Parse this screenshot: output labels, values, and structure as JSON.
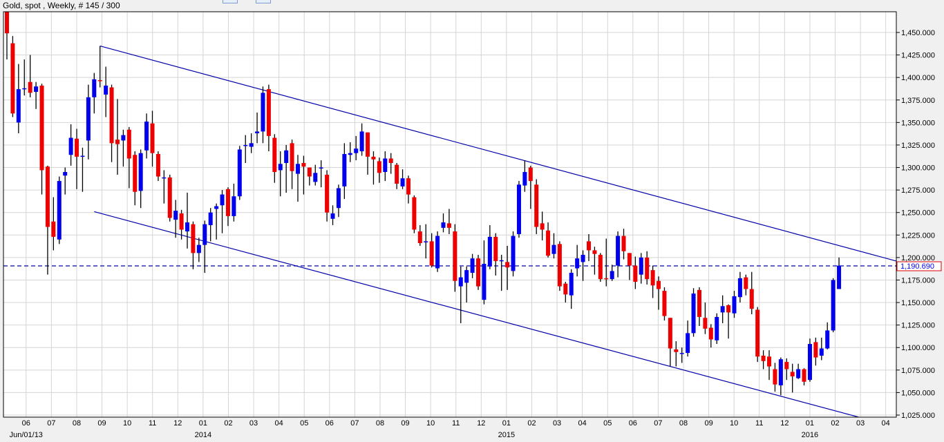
{
  "header": {
    "title": "Gold, spot , Weekly, # 145 / 300"
  },
  "colors": {
    "up": "#0000ee",
    "down": "#ee0000",
    "trend": "#0000aa",
    "grid": "#d4d4d4",
    "price_box": "#dd0000"
  },
  "chart_data": {
    "type": "candlestick",
    "title": "Gold, spot , Weekly, # 145 / 300",
    "ylim": [
      1025,
      1450
    ],
    "ytick_step": 25,
    "yticks": [
      "1,025.000",
      "1,050.000",
      "1,075.000",
      "1,100.000",
      "1,125.000",
      "1,150.000",
      "1,175.000",
      "1,200.000",
      "1,225.000",
      "1,250.000",
      "1,275.000",
      "1,300.000",
      "1,325.000",
      "1,350.000",
      "1,375.000",
      "1,400.000",
      "1,425.000",
      "1,450.000"
    ],
    "current_price": 1190.69,
    "current_price_label": "1,190.690",
    "x_first_month_week": 3.3,
    "weeks_per_month": 4.345,
    "month_labels": [
      "06",
      "07",
      "08",
      "09",
      "10",
      "11",
      "12",
      "01",
      "02",
      "03",
      "04",
      "05",
      "06",
      "07",
      "08",
      "09",
      "10",
      "11",
      "12",
      "01",
      "02",
      "03",
      "04",
      "05",
      "06",
      "07",
      "08",
      "09",
      "10",
      "11",
      "12",
      "01",
      "02",
      "03",
      "04"
    ],
    "year_labels": [
      {
        "month_index": 0,
        "label": "Jun/01/13"
      },
      {
        "month_index": 7,
        "label": "2014"
      },
      {
        "month_index": 19,
        "label": "2015"
      },
      {
        "month_index": 31,
        "label": "2016"
      }
    ],
    "trendlines": [
      {
        "name": "upper-channel",
        "from": [
          16,
          1435
        ],
        "to": [
          152.9,
          1196
        ]
      },
      {
        "name": "lower-channel",
        "from": [
          15,
          1251
        ],
        "to": [
          151.4,
          1014
        ]
      }
    ],
    "ohlc": [
      [
        1473,
        1475,
        1420,
        1449
      ],
      [
        1438,
        1446,
        1356,
        1360
      ],
      [
        1350,
        1415,
        1338,
        1387
      ],
      [
        1388,
        1420,
        1380,
        1388
      ],
      [
        1395,
        1425,
        1378,
        1383
      ],
      [
        1384,
        1395,
        1365,
        1390
      ],
      [
        1391,
        1393,
        1270,
        1297
      ],
      [
        1301,
        1302,
        1181,
        1234
      ],
      [
        1240,
        1267,
        1208,
        1223
      ],
      [
        1220,
        1290,
        1215,
        1285
      ],
      [
        1291,
        1300,
        1270,
        1295
      ],
      [
        1314,
        1348,
        1302,
        1333
      ],
      [
        1332,
        1343,
        1276,
        1312
      ],
      [
        1313,
        1322,
        1273,
        1313
      ],
      [
        1330,
        1392,
        1309,
        1378
      ],
      [
        1378,
        1405,
        1360,
        1398
      ],
      [
        1397,
        1435,
        1389,
        1396
      ],
      [
        1381,
        1412,
        1356,
        1391
      ],
      [
        1389,
        1392,
        1306,
        1327
      ],
      [
        1331,
        1376,
        1292,
        1326
      ],
      [
        1330,
        1342,
        1301,
        1336
      ],
      [
        1342,
        1345,
        1277,
        1310
      ],
      [
        1314,
        1318,
        1258,
        1273
      ],
      [
        1274,
        1320,
        1255,
        1316
      ],
      [
        1319,
        1360,
        1310,
        1351
      ],
      [
        1349,
        1363,
        1301,
        1316
      ],
      [
        1315,
        1318,
        1285,
        1290
      ],
      [
        1289,
        1297,
        1260,
        1289
      ],
      [
        1289,
        1292,
        1240,
        1244
      ],
      [
        1242,
        1264,
        1222,
        1252
      ],
      [
        1249,
        1253,
        1220,
        1231
      ],
      [
        1229,
        1272,
        1210,
        1239
      ],
      [
        1237,
        1240,
        1187,
        1205
      ],
      [
        1205,
        1222,
        1195,
        1214
      ],
      [
        1214,
        1241,
        1183,
        1237
      ],
      [
        1236,
        1255,
        1218,
        1250
      ],
      [
        1254,
        1260,
        1220,
        1257
      ],
      [
        1258,
        1275,
        1227,
        1270
      ],
      [
        1276,
        1278,
        1235,
        1246
      ],
      [
        1246,
        1282,
        1240,
        1268
      ],
      [
        1268,
        1324,
        1264,
        1320
      ],
      [
        1325,
        1336,
        1305,
        1325
      ],
      [
        1323,
        1338,
        1316,
        1327
      ],
      [
        1338,
        1361,
        1327,
        1340
      ],
      [
        1340,
        1390,
        1327,
        1383
      ],
      [
        1387,
        1392,
        1318,
        1335
      ],
      [
        1333,
        1337,
        1283,
        1295
      ],
      [
        1297,
        1318,
        1268,
        1304
      ],
      [
        1305,
        1325,
        1272,
        1319
      ],
      [
        1327,
        1331,
        1276,
        1296
      ],
      [
        1293,
        1314,
        1262,
        1304
      ],
      [
        1305,
        1313,
        1270,
        1301
      ],
      [
        1300,
        1300,
        1280,
        1290
      ],
      [
        1284,
        1303,
        1280,
        1294
      ],
      [
        1300,
        1308,
        1278,
        1300
      ],
      [
        1292,
        1297,
        1240,
        1250
      ],
      [
        1243,
        1258,
        1236,
        1249
      ],
      [
        1255,
        1281,
        1245,
        1277
      ],
      [
        1279,
        1327,
        1265,
        1315
      ],
      [
        1314,
        1328,
        1306,
        1316
      ],
      [
        1316,
        1335,
        1308,
        1321
      ],
      [
        1318,
        1349,
        1313,
        1340
      ],
      [
        1339,
        1339,
        1292,
        1312
      ],
      [
        1312,
        1318,
        1281,
        1309
      ],
      [
        1307,
        1311,
        1283,
        1294
      ],
      [
        1295,
        1318,
        1285,
        1310
      ],
      [
        1310,
        1316,
        1293,
        1305
      ],
      [
        1303,
        1305,
        1276,
        1282
      ],
      [
        1279,
        1298,
        1276,
        1288
      ],
      [
        1288,
        1291,
        1260,
        1270
      ],
      [
        1267,
        1269,
        1227,
        1231
      ],
      [
        1229,
        1236,
        1213,
        1216
      ],
      [
        1218,
        1237,
        1199,
        1218
      ],
      [
        1218,
        1227,
        1189,
        1191
      ],
      [
        1188,
        1229,
        1184,
        1224
      ],
      [
        1233,
        1249,
        1228,
        1239
      ],
      [
        1238,
        1254,
        1226,
        1233
      ],
      [
        1229,
        1237,
        1162,
        1174
      ],
      [
        1168,
        1190,
        1127,
        1178
      ],
      [
        1172,
        1190,
        1150,
        1186
      ],
      [
        1183,
        1204,
        1177,
        1199
      ],
      [
        1199,
        1203,
        1164,
        1168
      ],
      [
        1153,
        1219,
        1148,
        1193
      ],
      [
        1190,
        1236,
        1187,
        1223
      ],
      [
        1223,
        1227,
        1180,
        1196
      ],
      [
        1197,
        1203,
        1163,
        1197
      ],
      [
        1195,
        1213,
        1164,
        1189
      ],
      [
        1185,
        1229,
        1179,
        1224
      ],
      [
        1226,
        1285,
        1222,
        1281
      ],
      [
        1280,
        1308,
        1273,
        1295
      ],
      [
        1300,
        1302,
        1254,
        1285
      ],
      [
        1281,
        1287,
        1226,
        1234
      ],
      [
        1238,
        1251,
        1219,
        1231
      ],
      [
        1230,
        1239,
        1200,
        1202
      ],
      [
        1204,
        1227,
        1199,
        1214
      ],
      [
        1215,
        1218,
        1163,
        1168
      ],
      [
        1171,
        1173,
        1150,
        1159
      ],
      [
        1158,
        1187,
        1143,
        1183
      ],
      [
        1188,
        1214,
        1179,
        1199
      ],
      [
        1195,
        1208,
        1174,
        1203
      ],
      [
        1218,
        1226,
        1196,
        1208
      ],
      [
        1208,
        1212,
        1181,
        1204
      ],
      [
        1203,
        1205,
        1173,
        1176
      ],
      [
        1177,
        1221,
        1168,
        1176
      ],
      [
        1176,
        1192,
        1174,
        1185
      ],
      [
        1191,
        1229,
        1178,
        1224
      ],
      [
        1224,
        1232,
        1198,
        1207
      ],
      [
        1205,
        1205,
        1175,
        1191
      ],
      [
        1191,
        1201,
        1165,
        1173
      ],
      [
        1181,
        1205,
        1171,
        1200
      ],
      [
        1200,
        1207,
        1170,
        1176
      ],
      [
        1186,
        1191,
        1155,
        1169
      ],
      [
        1174,
        1179,
        1142,
        1165
      ],
      [
        1163,
        1167,
        1130,
        1135
      ],
      [
        1133,
        1133,
        1079,
        1099
      ],
      [
        1098,
        1107,
        1079,
        1095
      ],
      [
        1094,
        1100,
        1083,
        1094
      ],
      [
        1094,
        1130,
        1090,
        1116
      ],
      [
        1116,
        1166,
        1112,
        1160
      ],
      [
        1164,
        1167,
        1124,
        1134
      ],
      [
        1133,
        1150,
        1115,
        1121
      ],
      [
        1122,
        1126,
        1100,
        1109
      ],
      [
        1108,
        1138,
        1104,
        1134
      ],
      [
        1139,
        1158,
        1127,
        1146
      ],
      [
        1147,
        1148,
        1110,
        1139
      ],
      [
        1138,
        1163,
        1133,
        1157
      ],
      [
        1156,
        1184,
        1150,
        1177
      ],
      [
        1178,
        1181,
        1158,
        1165
      ],
      [
        1165,
        1184,
        1137,
        1143
      ],
      [
        1142,
        1145,
        1084,
        1090
      ],
      [
        1091,
        1097,
        1076,
        1085
      ],
      [
        1090,
        1097,
        1064,
        1079
      ],
      [
        1076,
        1083,
        1051,
        1059
      ],
      [
        1058,
        1089,
        1047,
        1087
      ],
      [
        1084,
        1088,
        1064,
        1076
      ],
      [
        1073,
        1082,
        1050,
        1068
      ],
      [
        1066,
        1082,
        1065,
        1076
      ],
      [
        1076,
        1077,
        1058,
        1062
      ],
      [
        1064,
        1110,
        1062,
        1104
      ],
      [
        1106,
        1111,
        1080,
        1089
      ],
      [
        1091,
        1111,
        1086,
        1099
      ],
      [
        1099,
        1128,
        1098,
        1119
      ],
      [
        1119,
        1177,
        1117,
        1175
      ],
      [
        1165,
        1200,
        1165,
        1191
      ]
    ]
  }
}
